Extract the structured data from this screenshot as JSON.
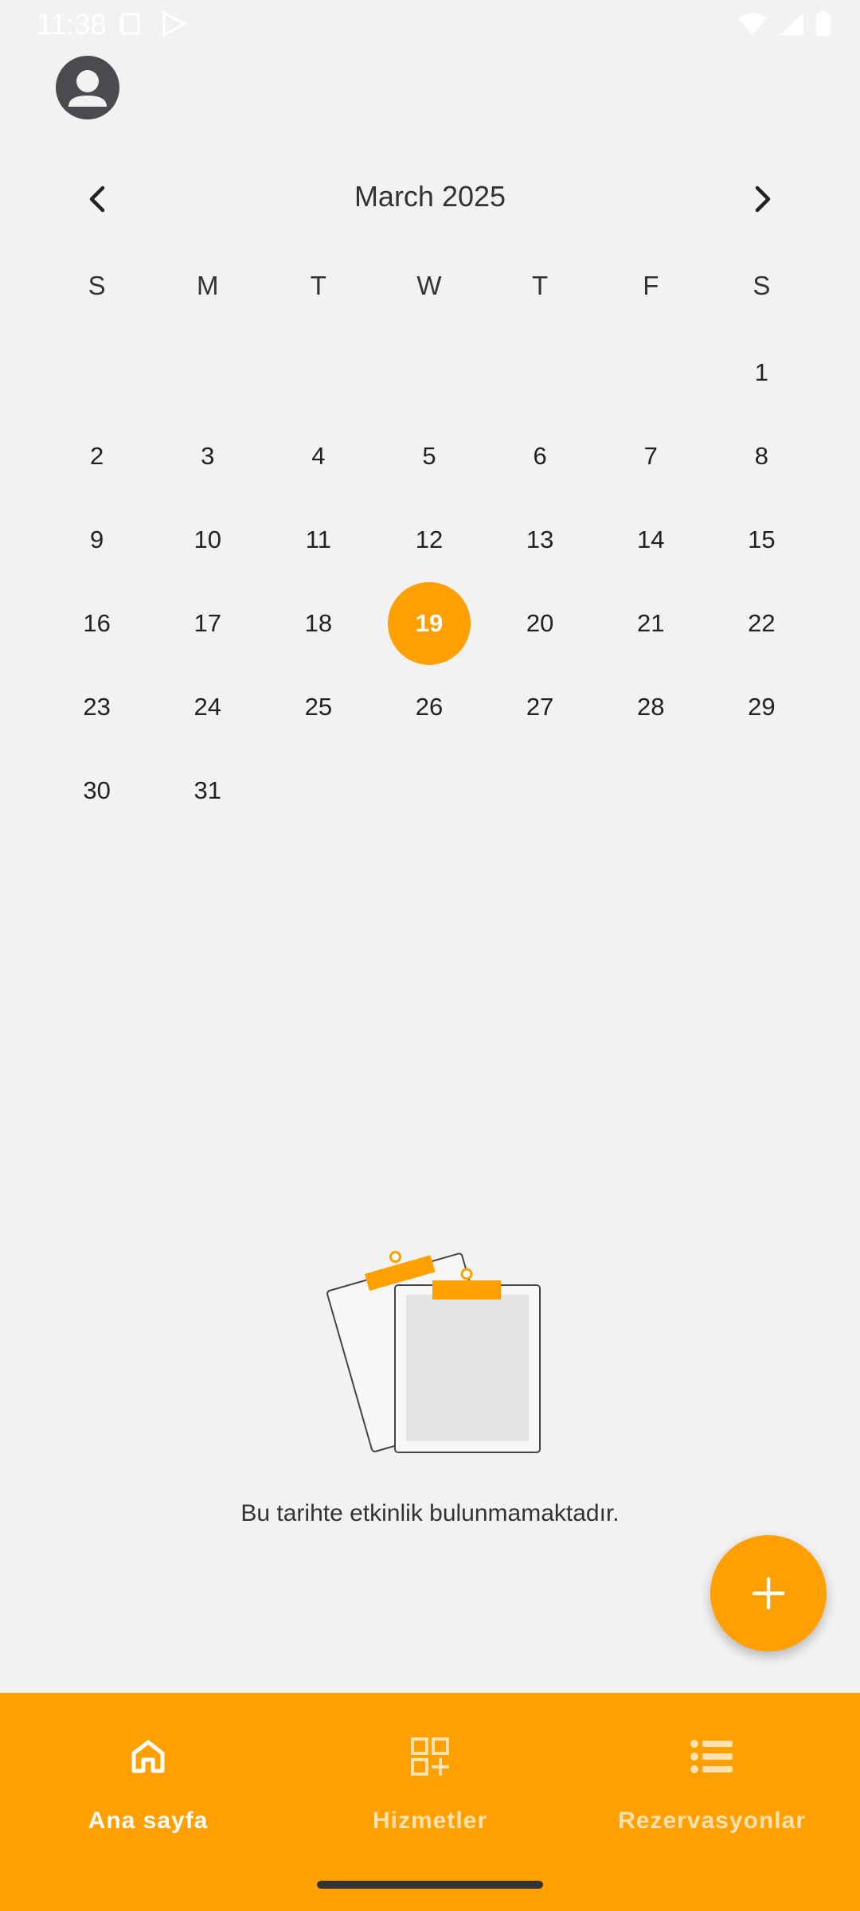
{
  "status_bar": {
    "time": "11:38"
  },
  "calendar": {
    "month_title": "March 2025",
    "weekdays": [
      "S",
      "M",
      "T",
      "W",
      "T",
      "F",
      "S"
    ],
    "leading_blanks": 6,
    "days": [
      "1",
      "2",
      "3",
      "4",
      "5",
      "6",
      "7",
      "8",
      "9",
      "10",
      "11",
      "12",
      "13",
      "14",
      "15",
      "16",
      "17",
      "18",
      "19",
      "20",
      "21",
      "22",
      "23",
      "24",
      "25",
      "26",
      "27",
      "28",
      "29",
      "30",
      "31"
    ],
    "selected_day": "19"
  },
  "empty_state": {
    "message": "Bu tarihte etkinlik bulunmamaktadır."
  },
  "bottom_nav": {
    "items": [
      {
        "label": "Ana sayfa",
        "icon": "home-icon",
        "active": true
      },
      {
        "label": "Hizmetler",
        "icon": "grid-add-icon",
        "active": false
      },
      {
        "label": "Rezervasyonlar",
        "icon": "list-icon",
        "active": false
      }
    ]
  },
  "colors": {
    "accent": "#FF9F00",
    "background": "#f2f2f2"
  }
}
